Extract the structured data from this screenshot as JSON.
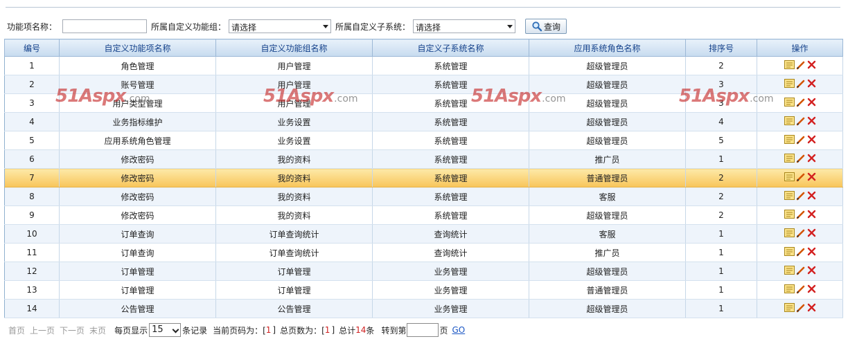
{
  "filters": {
    "name_label": "功能项名称：",
    "name_value": "",
    "group_label": "所属自定义功能组：",
    "group_select": "请选择",
    "subsystem_label": "所属自定义子系统：",
    "subsystem_select": "请选择",
    "query_label": "查询"
  },
  "table": {
    "headers": [
      "编号",
      "自定义功能项名称",
      "自定义功能组名称",
      "自定义子系统名称",
      "应用系统角色名称",
      "排序号",
      "操作"
    ],
    "rows": [
      [
        "1",
        "角色管理",
        "用户管理",
        "系统管理",
        "超级管理员",
        "2"
      ],
      [
        "2",
        "账号管理",
        "用户管理",
        "系统管理",
        "超级管理员",
        "3"
      ],
      [
        "3",
        "用户类型管理",
        "用户管理",
        "系统管理",
        "超级管理员",
        "3"
      ],
      [
        "4",
        "业务指标维护",
        "业务设置",
        "系统管理",
        "超级管理员",
        "4"
      ],
      [
        "5",
        "应用系统角色管理",
        "业务设置",
        "系统管理",
        "超级管理员",
        "5"
      ],
      [
        "6",
        "修改密码",
        "我的资料",
        "系统管理",
        "推广员",
        "1"
      ],
      [
        "7",
        "修改密码",
        "我的资料",
        "系统管理",
        "普通管理员",
        "2"
      ],
      [
        "8",
        "修改密码",
        "我的资料",
        "系统管理",
        "客服",
        "2"
      ],
      [
        "9",
        "修改密码",
        "我的资料",
        "系统管理",
        "超级管理员",
        "2"
      ],
      [
        "10",
        "订单查询",
        "订单查询统计",
        "查询统计",
        "客服",
        "1"
      ],
      [
        "11",
        "订单查询",
        "订单查询统计",
        "查询统计",
        "推广员",
        "1"
      ],
      [
        "12",
        "订单管理",
        "订单管理",
        "业务管理",
        "超级管理员",
        "1"
      ],
      [
        "13",
        "订单管理",
        "订单管理",
        "业务管理",
        "普通管理员",
        "1"
      ],
      [
        "14",
        "公告管理",
        "公告管理",
        "业务管理",
        "超级管理员",
        "1"
      ]
    ],
    "highlighted_row_index": 6,
    "row_action_icons": [
      "view-icon",
      "edit-icon",
      "delete-icon"
    ]
  },
  "watermark": {
    "main": "51Aspx",
    "sub": ".com"
  },
  "pager": {
    "first": "首页",
    "prev": "上一页",
    "next": "下一页",
    "last": "末页",
    "per_page_label": "每页显示",
    "per_page_value": "15",
    "per_page_suffix": "条记录",
    "current_label": "当前页码为：[",
    "current_value": "1",
    "bracket_close": "]",
    "total_pages_label": "总页数为：[",
    "total_pages_value": "1",
    "total_label": "总计",
    "total_value": "14",
    "total_suffix": "条",
    "goto_label": "转到第",
    "goto_value": "",
    "goto_suffix": "页",
    "go_label": "GO"
  },
  "colors": {
    "header_text": "#15428b",
    "highlight_row": "#f8c55a",
    "alt_row": "#eef4fb",
    "pager_number": "#d01f1f",
    "go_link": "#1a56c4"
  }
}
